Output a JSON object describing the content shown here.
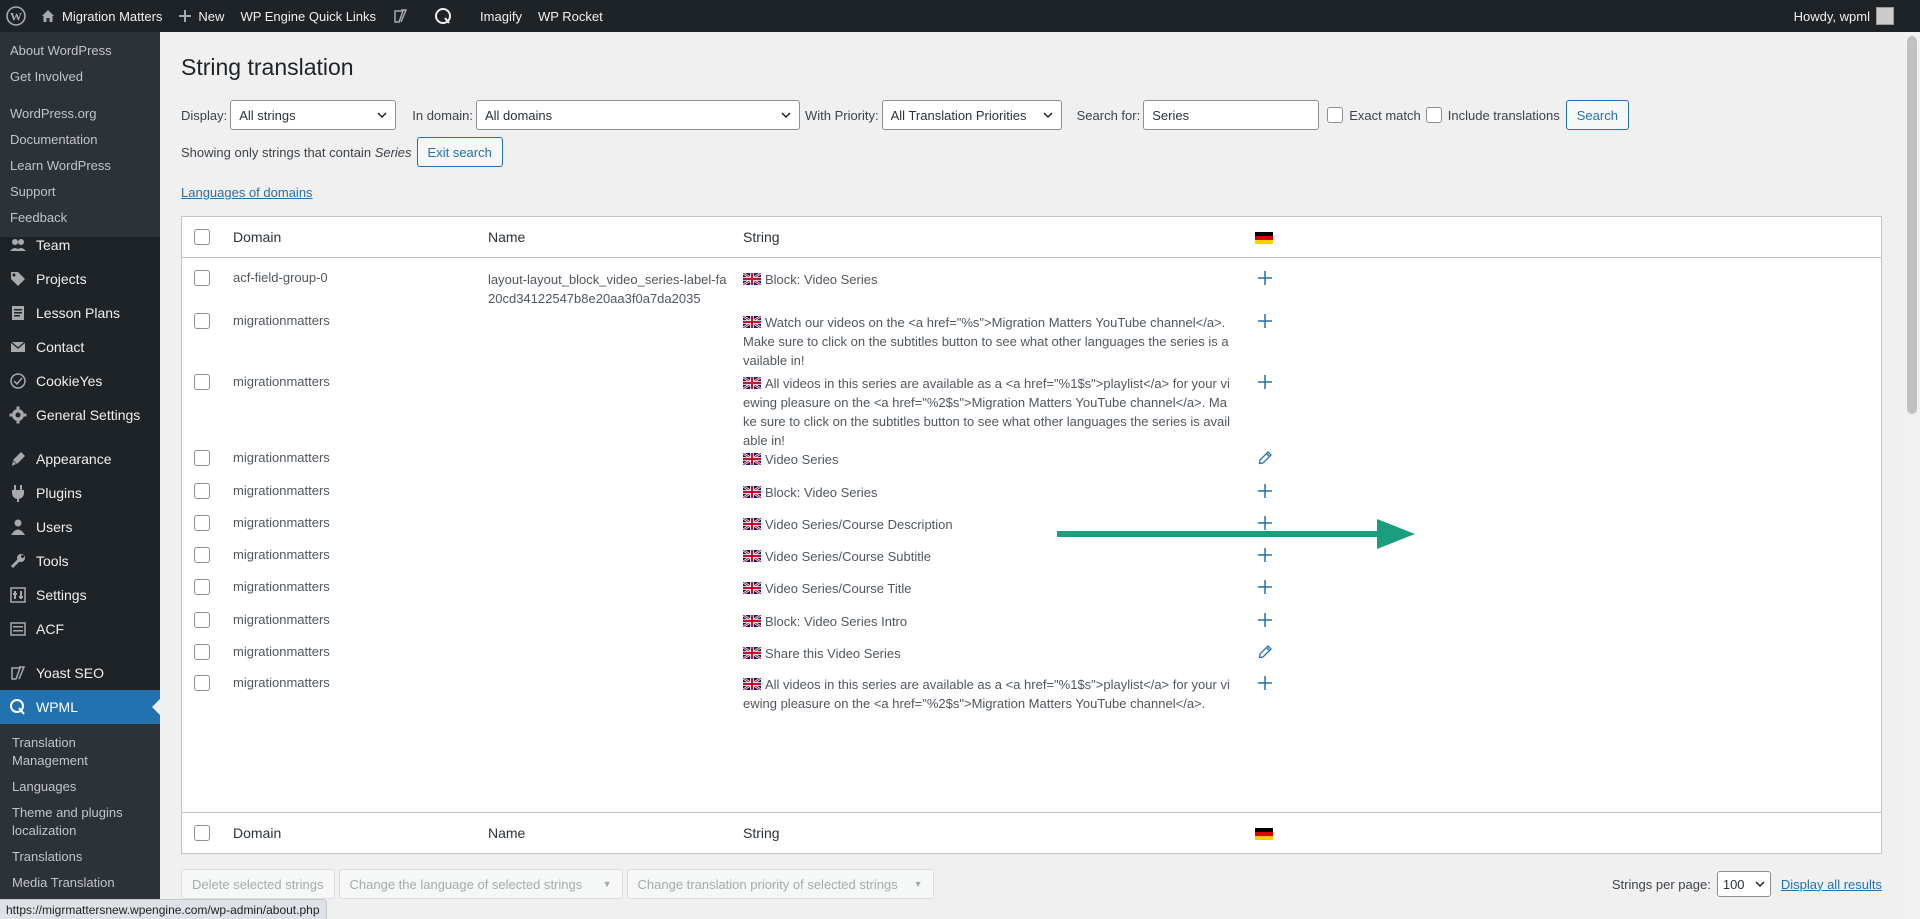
{
  "adminbar": {
    "site_name": "Migration Matters",
    "new_label": "New",
    "quick_links": "WP Engine Quick Links",
    "imagify": "Imagify",
    "wp_rocket": "WP Rocket",
    "howdy": "Howdy, wpml"
  },
  "sidebar": {
    "flyout": [
      "About WordPress",
      "Get Involved",
      "WordPress.org",
      "Documentation",
      "Learn WordPress",
      "Support",
      "Feedback"
    ],
    "menu": [
      {
        "label": "Team",
        "icon": "team-icon"
      },
      {
        "label": "Projects",
        "icon": "projects-icon"
      },
      {
        "label": "Lesson Plans",
        "icon": "lesson-plans-icon"
      },
      {
        "label": "Contact",
        "icon": "contact-icon"
      },
      {
        "label": "CookieYes",
        "icon": "cookieyes-icon"
      },
      {
        "label": "General Settings",
        "icon": "gear-icon"
      },
      {
        "label": "Appearance",
        "icon": "appearance-icon"
      },
      {
        "label": "Plugins",
        "icon": "plugins-icon"
      },
      {
        "label": "Users",
        "icon": "users-icon"
      },
      {
        "label": "Tools",
        "icon": "tools-icon"
      },
      {
        "label": "Settings",
        "icon": "settings-icon"
      },
      {
        "label": "ACF",
        "icon": "acf-icon"
      },
      {
        "label": "Yoast SEO",
        "icon": "yoast-icon"
      },
      {
        "label": "WPML",
        "icon": "wpml-icon"
      }
    ],
    "submenu": [
      "Translation Management",
      "Languages",
      "Theme and plugins localization",
      "Translations",
      "Media Translation"
    ]
  },
  "page": {
    "title": "String translation",
    "display_label": "Display:",
    "display_value": "All strings",
    "domain_label": "In domain:",
    "domain_value": "All domains",
    "priority_label": "With Priority:",
    "priority_value": "All Translation Priorities",
    "search_label": "Search for:",
    "search_value": "Series",
    "exact_match": "Exact match",
    "include_translations": "Include translations",
    "search_button": "Search",
    "showing_prefix": "Showing only strings that contain",
    "showing_term": "Series",
    "exit_search": "Exit search",
    "languages_link": "Languages of domains"
  },
  "table": {
    "headers": {
      "domain": "Domain",
      "name": "Name",
      "string": "String"
    },
    "rows": [
      {
        "domain": "acf-field-group-0",
        "name": "layout-layout_block_video_series-label-fa20cd34122547b8e20aa3f0a7da2035",
        "string": "Block: Video Series",
        "action": "add"
      },
      {
        "domain": "migrationmatters",
        "name": "",
        "string": "Watch our videos on the <a href=\"%s\">Migration Matters YouTube channel</a>. Make sure to click on the subtitles button to see what other languages the series is available in!",
        "action": "add"
      },
      {
        "domain": "migrationmatters",
        "name": "",
        "string": "All videos in this series are available as a <a href=\"%1$s\">playlist</a> for your viewing pleasure on the <a href=\"%2$s\">Migration Matters YouTube channel</a>. Make sure to click on the subtitles button to see what other languages the series is available in!",
        "action": "add"
      },
      {
        "domain": "migrationmatters",
        "name": "",
        "string": "Video Series",
        "action": "edit"
      },
      {
        "domain": "migrationmatters",
        "name": "",
        "string": "Block: Video Series",
        "action": "add"
      },
      {
        "domain": "migrationmatters",
        "name": "",
        "string": "Video Series/Course Description",
        "action": "add"
      },
      {
        "domain": "migrationmatters",
        "name": "",
        "string": "Video Series/Course Subtitle",
        "action": "add"
      },
      {
        "domain": "migrationmatters",
        "name": "",
        "string": "Video Series/Course Title",
        "action": "add"
      },
      {
        "domain": "migrationmatters",
        "name": "",
        "string": "Block: Video Series Intro",
        "action": "add"
      },
      {
        "domain": "migrationmatters",
        "name": "",
        "string": "Share this Video Series",
        "action": "edit"
      },
      {
        "domain": "migrationmatters",
        "name": "",
        "string": "All videos in this series are available as a <a href=\"%1$s\">playlist</a> for your viewing pleasure on the <a href=\"%2$s\">Migration Matters YouTube channel</a>.",
        "action": "add"
      }
    ]
  },
  "bottom": {
    "delete": "Delete selected strings",
    "change_language": "Change the language of selected strings",
    "change_priority": "Change translation priority of selected strings",
    "per_page_label": "Strings per page:",
    "per_page_value": "100",
    "display_all": "Display all results"
  },
  "status_url": "https://migrmattersnew.wpengine.com/wp-admin/about.php",
  "colors": {
    "accent": "#2271b1",
    "annotation_arrow": "#1a9e7f",
    "sidebar": "#1d2327"
  }
}
